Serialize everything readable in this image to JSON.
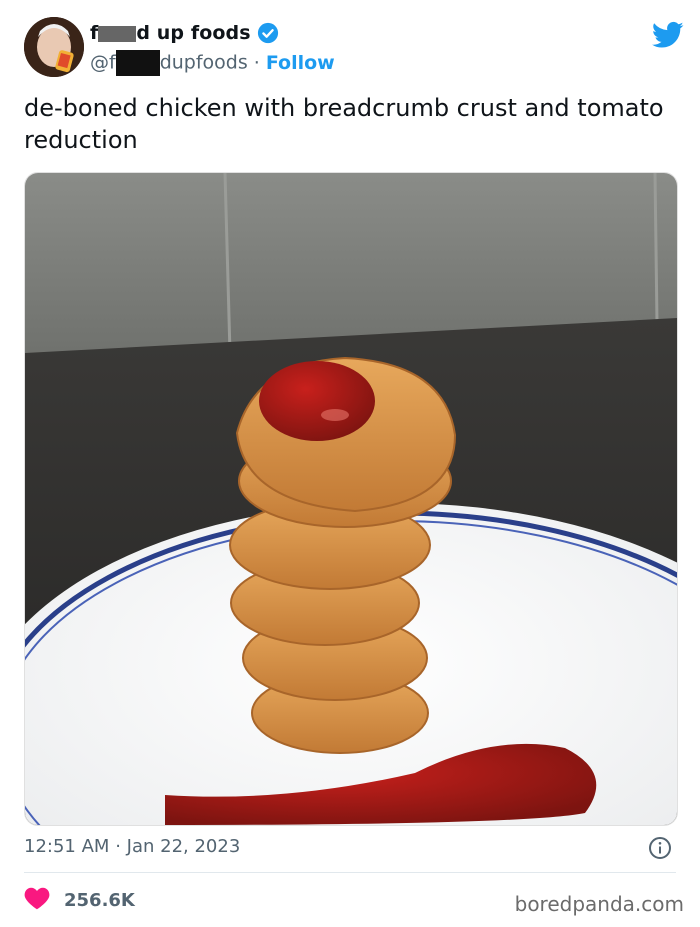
{
  "account": {
    "name_prefix": "f",
    "name_suffix": "d up foods",
    "handle_prefix": "@f",
    "handle_suffix": "dupfoods",
    "separator": "·",
    "follow_label": "Follow",
    "verified": true
  },
  "tweet": {
    "text": "de-boned chicken with breadcrumb crust and tomato reduction",
    "time": "12:51 AM",
    "date_separator": "·",
    "date": "Jan 22, 2023",
    "likes": "256.6K"
  },
  "icons": {
    "twitter": "twitter-bird-icon",
    "verified": "verified-badge-icon",
    "info": "info-icon",
    "like": "heart-icon"
  },
  "colors": {
    "accent": "#1d9bf0",
    "like": "#f91880",
    "muted": "#536471"
  },
  "watermark": "boredpanda.com"
}
